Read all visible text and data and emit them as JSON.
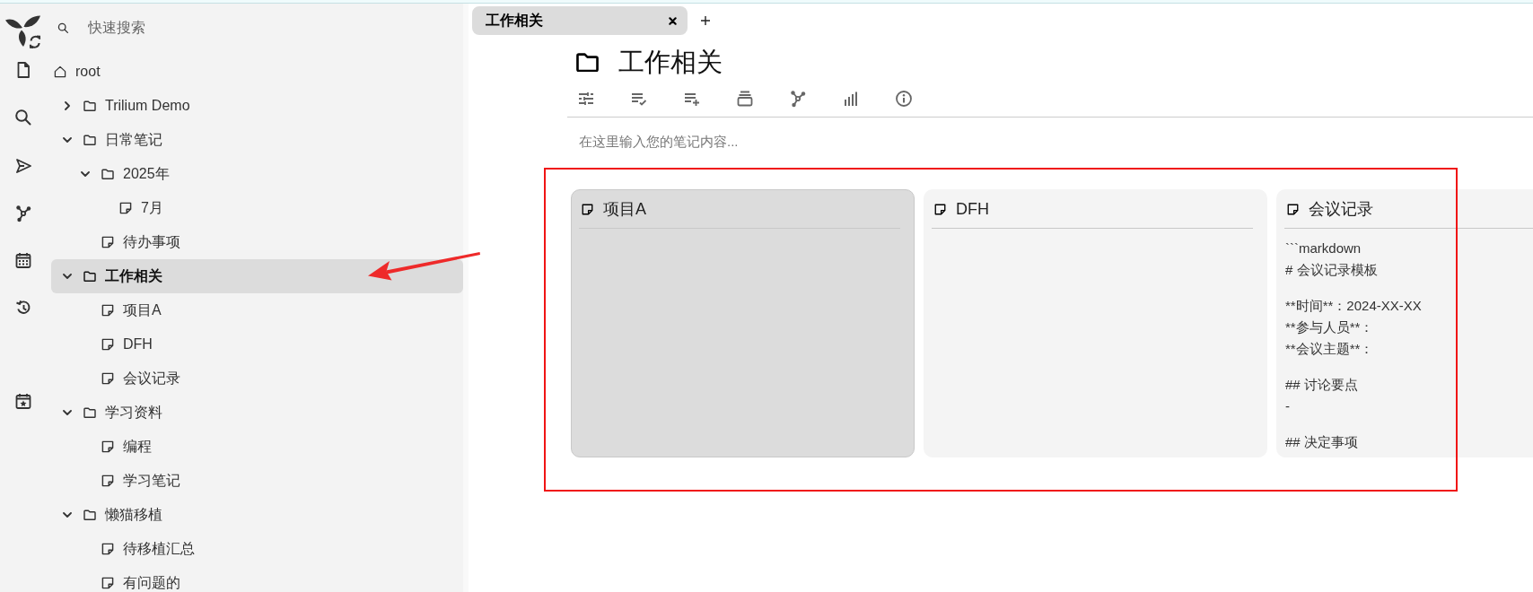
{
  "quick_search": {
    "placeholder": "快速搜索"
  },
  "tree": [
    {
      "label": "root",
      "kind": "root",
      "selected": false,
      "children": [
        {
          "label": "Trilium Demo",
          "kind": "folder",
          "expanded": false,
          "selected": false
        },
        {
          "label": "日常笔记",
          "kind": "folder",
          "expanded": true,
          "selected": false,
          "children": [
            {
              "label": "2025年",
              "kind": "folder",
              "expanded": true,
              "selected": false,
              "children": [
                {
                  "label": "7月",
                  "kind": "note",
                  "selected": false
                }
              ]
            },
            {
              "label": "待办事项",
              "kind": "note",
              "selected": false
            }
          ]
        },
        {
          "label": "工作相关",
          "kind": "folder",
          "expanded": true,
          "selected": true,
          "children": [
            {
              "label": "项目A",
              "kind": "note",
              "selected": false
            },
            {
              "label": "DFH",
              "kind": "note",
              "selected": false
            },
            {
              "label": "会议记录",
              "kind": "note",
              "selected": false
            }
          ]
        },
        {
          "label": "学习资料",
          "kind": "folder",
          "expanded": true,
          "selected": false,
          "children": [
            {
              "label": "编程",
              "kind": "note",
              "selected": false
            },
            {
              "label": "学习笔记",
              "kind": "note",
              "selected": false
            }
          ]
        },
        {
          "label": "懒猫移植",
          "kind": "folder",
          "expanded": true,
          "selected": false,
          "children": [
            {
              "label": "待移植汇总",
              "kind": "note",
              "selected": false
            },
            {
              "label": "有问题的",
              "kind": "note",
              "selected": false
            }
          ]
        }
      ]
    }
  ],
  "tabs": [
    {
      "label": "工作相关",
      "selected": true
    }
  ],
  "note": {
    "title": "工作相关"
  },
  "editor": {
    "placeholder": "在这里输入您的笔记内容..."
  },
  "cards": [
    {
      "title": "项目A",
      "highlighted": true
    },
    {
      "title": "DFH",
      "highlighted": false
    },
    {
      "title": "会议记录",
      "highlighted": false,
      "paragraphs": [
        [
          "```markdown",
          "# 会议记录模板"
        ],
        [
          "**时间**：2024-XX-XX",
          "**参与人员**：",
          "**会议主题**："
        ],
        [
          "## 讨论要点",
          "-"
        ],
        [
          "## 决定事项"
        ]
      ]
    }
  ],
  "annotations": {
    "frame": true,
    "arrow": true
  }
}
